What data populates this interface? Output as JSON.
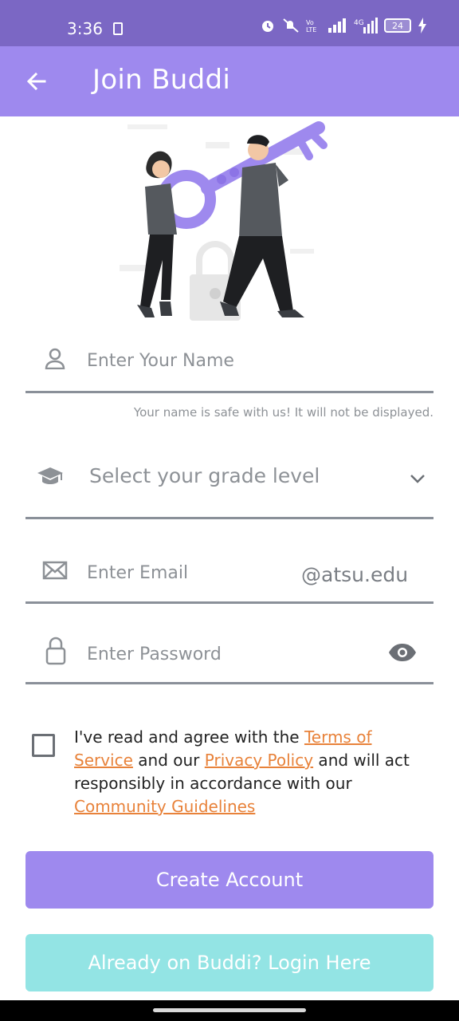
{
  "status_bar": {
    "time": "3:36",
    "battery": "24"
  },
  "app_bar": {
    "title": "Join Buddi"
  },
  "form": {
    "name_placeholder": "Enter Your Name",
    "name_hint": "Your name is safe with us! It will not be displayed.",
    "grade_placeholder": "Select your grade level",
    "email_placeholder": "Enter Email",
    "email_suffix": "@atsu.edu",
    "password_placeholder": "Enter Password"
  },
  "agreement": {
    "part1": "I've read and agree with the ",
    "terms_link": "Terms of Service",
    "part2": " and our ",
    "privacy_link": "Privacy Policy",
    "part3": " and will act responsibly in accordance with our ",
    "guidelines_link": "Community Guidelines"
  },
  "buttons": {
    "create_account": "Create Account",
    "login": "Already on Buddi? Login Here"
  },
  "colors": {
    "primary": "#9e89ee",
    "status_bar": "#7b67c4",
    "secondary": "#93e4e4",
    "link": "#e8823a"
  },
  "icons": {
    "back": "arrow-left-icon",
    "name": "person-icon",
    "grade": "graduation-cap-icon",
    "dropdown": "chevron-down-icon",
    "email": "envelope-icon",
    "password": "lock-icon",
    "visibility": "eye-icon"
  }
}
